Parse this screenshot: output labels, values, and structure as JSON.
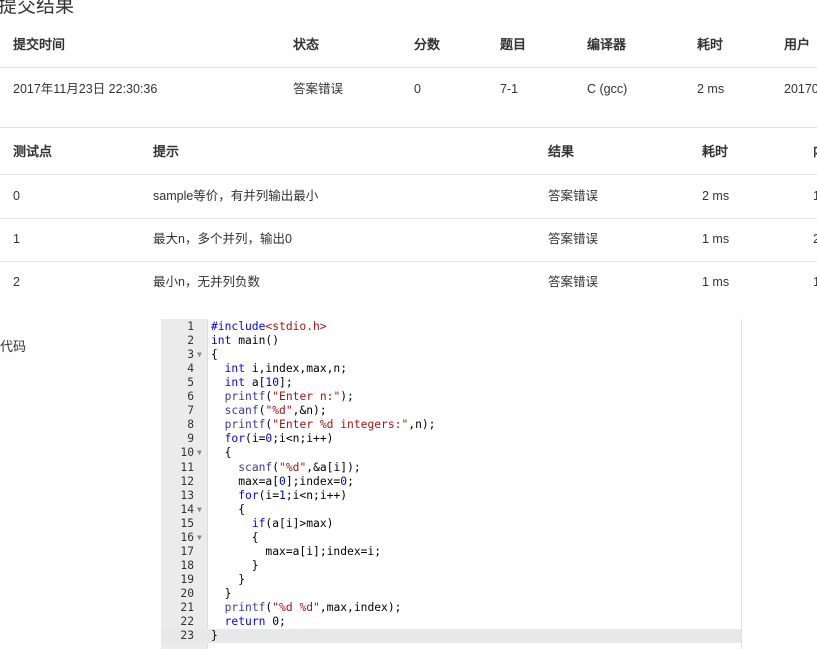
{
  "page": {
    "title": "提交结果"
  },
  "submission_table": {
    "headers": [
      "提交时间",
      "状态",
      "分数",
      "题目",
      "编译器",
      "耗时",
      "用户"
    ],
    "row": {
      "time": "2017年11月23日 22:30:36",
      "status": "答案错误",
      "score": "0",
      "problem": "7-1",
      "compiler": "C (gcc)",
      "elapsed": "2 ms",
      "user": "20170"
    }
  },
  "test_table": {
    "headers": [
      "测试点",
      "提示",
      "结果",
      "耗时",
      "内"
    ],
    "rows": [
      {
        "id": "0",
        "hint": "sample等价，有并列输出最小",
        "result": "答案错误",
        "time": "2 ms",
        "mem": "1"
      },
      {
        "id": "1",
        "hint": "最大n，多个并列，输出0",
        "result": "答案错误",
        "time": "1 ms",
        "mem": "2"
      },
      {
        "id": "2",
        "hint": "最小n，无并列负数",
        "result": "答案错误",
        "time": "1 ms",
        "mem": "1"
      }
    ]
  },
  "code_section": {
    "label": "代码",
    "lines": [
      {
        "n": "1",
        "fold": "",
        "text": "#include<stdio.h>"
      },
      {
        "n": "2",
        "fold": "",
        "text": "int main()"
      },
      {
        "n": "3",
        "fold": "▼",
        "text": "{"
      },
      {
        "n": "4",
        "fold": "",
        "text": "  int i,index,max,n;"
      },
      {
        "n": "5",
        "fold": "",
        "text": "  int a[10];"
      },
      {
        "n": "6",
        "fold": "",
        "text": "  printf(\"Enter n:\");"
      },
      {
        "n": "7",
        "fold": "",
        "text": "  scanf(\"%d\",&n);"
      },
      {
        "n": "8",
        "fold": "",
        "text": "  printf(\"Enter %d integers:\",n);"
      },
      {
        "n": "9",
        "fold": "",
        "text": "  for(i=0;i<n;i++)"
      },
      {
        "n": "10",
        "fold": "▼",
        "text": "  {"
      },
      {
        "n": "11",
        "fold": "",
        "text": "    scanf(\"%d\",&a[i]);"
      },
      {
        "n": "12",
        "fold": "",
        "text": "    max=a[0];index=0;"
      },
      {
        "n": "13",
        "fold": "",
        "text": "    for(i=1;i<n;i++)"
      },
      {
        "n": "14",
        "fold": "▼",
        "text": "    {"
      },
      {
        "n": "15",
        "fold": "",
        "text": "      if(a[i]>max)"
      },
      {
        "n": "16",
        "fold": "▼",
        "text": "      {"
      },
      {
        "n": "17",
        "fold": "",
        "text": "        max=a[i];index=i;"
      },
      {
        "n": "18",
        "fold": "",
        "text": "      }"
      },
      {
        "n": "19",
        "fold": "",
        "text": "    }"
      },
      {
        "n": "20",
        "fold": "",
        "text": "  }"
      },
      {
        "n": "21",
        "fold": "",
        "text": "  printf(\"%d %d\",max,index);"
      },
      {
        "n": "22",
        "fold": "",
        "text": "  return 0;"
      },
      {
        "n": "23",
        "fold": "",
        "text": "}"
      }
    ]
  },
  "colors": {
    "status_error": "#4caf50",
    "link": "#1e5fa8",
    "keyword": "#0000ff",
    "string": "#a31515"
  }
}
